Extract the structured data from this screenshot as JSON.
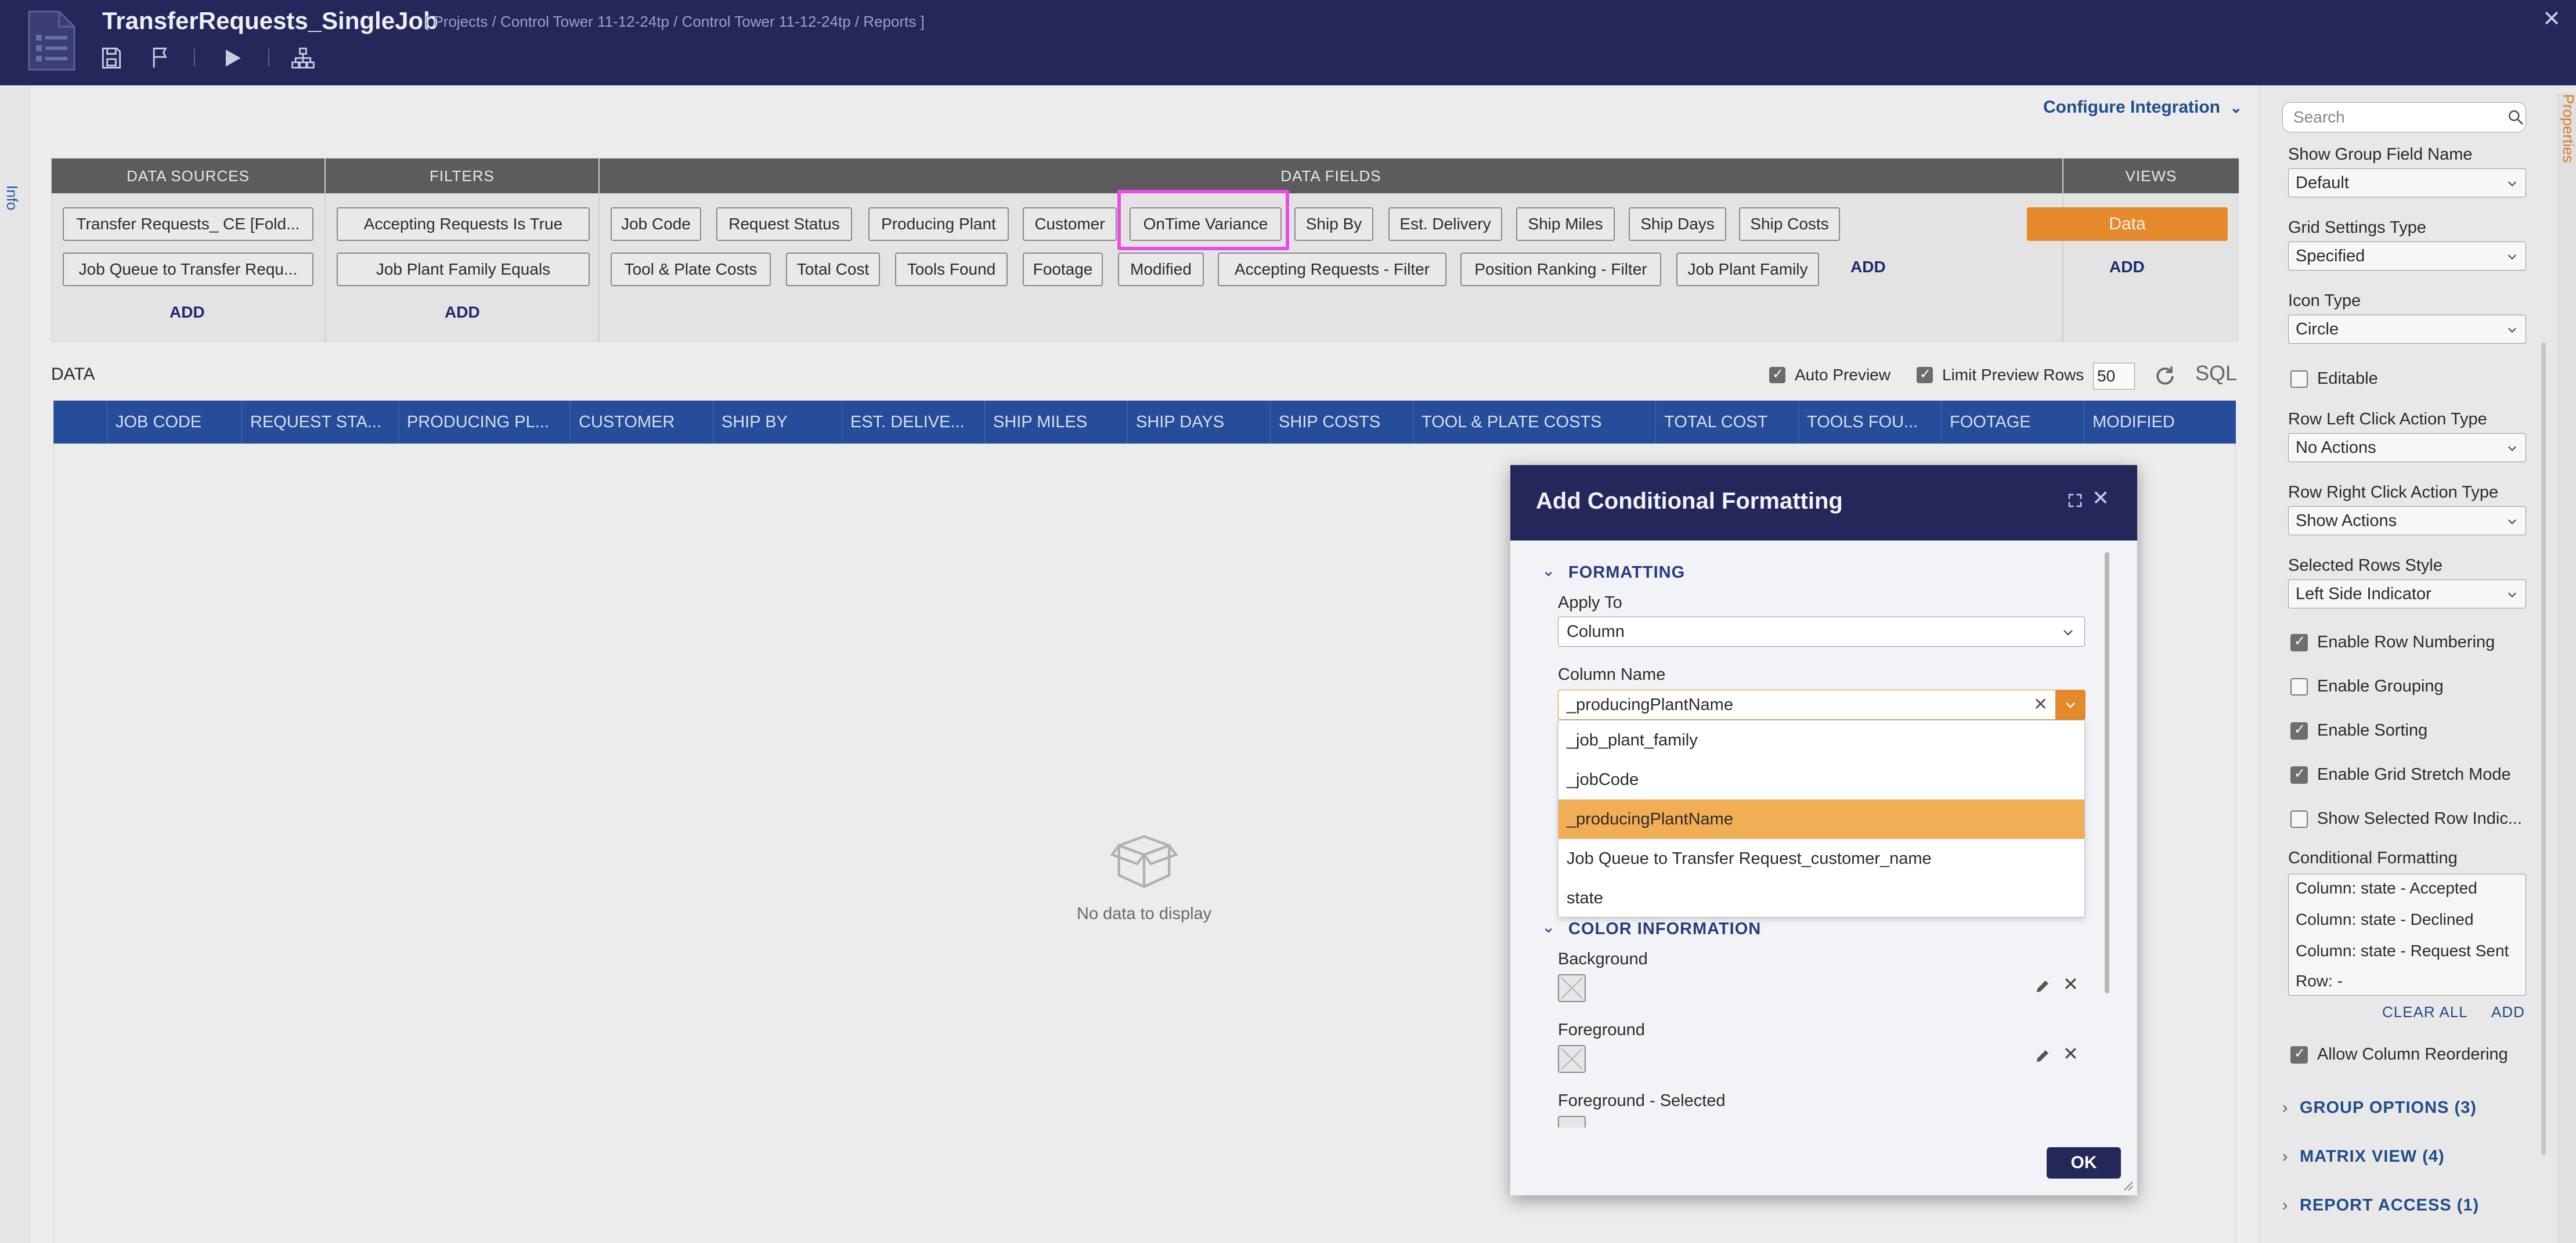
{
  "header": {
    "title": "TransferRequests_SingleJob",
    "breadcrumb": "[ Projects / Control Tower 11-12-24tp / Control Tower 11-12-24tp / Reports ]"
  },
  "sidebar": {
    "info_label": "Info"
  },
  "canvas": {
    "configure_integration": "Configure Integration"
  },
  "designer": {
    "headers": {
      "data_sources": "DATA SOURCES",
      "filters": "FILTERS",
      "data_fields": "DATA FIELDS",
      "views": "VIEWS"
    },
    "data_sources": [
      "Transfer Requests_ CE [Fold...",
      "Job Queue to Transfer Requ..."
    ],
    "filters": [
      "Accepting Requests Is True",
      "Job Plant Family Equals"
    ],
    "data_fields_row1": [
      "Job Code",
      "Request Status",
      "Producing Plant",
      "Customer",
      "OnTime Variance",
      "Ship By",
      "Est. Delivery",
      "Ship Miles",
      "Ship Days",
      "Ship Costs"
    ],
    "data_fields_row2": [
      "Tool & Plate Costs",
      "Total Cost",
      "Tools Found",
      "Footage",
      "Modified",
      "Accepting Requests - Filter",
      "Position Ranking - Filter",
      "Job Plant Family"
    ],
    "views": [
      "Data"
    ],
    "add_label": "ADD"
  },
  "data_section": {
    "title": "DATA",
    "auto_preview": "Auto Preview",
    "limit_preview_rows": "Limit Preview Rows",
    "preview_rows_value": "50",
    "sql_label": "SQL",
    "columns": [
      "JOB CODE",
      "REQUEST STA...",
      "PRODUCING PL...",
      "CUSTOMER",
      "SHIP BY",
      "EST. DELIVE...",
      "SHIP MILES",
      "SHIP DAYS",
      "SHIP COSTS",
      "TOOL & PLATE COSTS",
      "TOTAL COST",
      "TOOLS FOU...",
      "FOOTAGE",
      "MODIFIED"
    ],
    "empty_text": "No data to display"
  },
  "modal": {
    "title": "Add Conditional Formatting",
    "formatting_section": "FORMATTING",
    "apply_to_label": "Apply To",
    "apply_to_value": "Column",
    "column_name_label": "Column Name",
    "column_name_value": "_producingPlantName",
    "options": [
      "_job_plant_family",
      "_jobCode",
      "_producingPlantName",
      "Job Queue to Transfer Request_customer_name",
      "state"
    ],
    "selected_option": "_producingPlantName",
    "color_section": "COLOR INFORMATION",
    "background_label": "Background",
    "foreground_label": "Foreground",
    "foreground_selected_label": "Foreground - Selected",
    "ok_label": "OK"
  },
  "properties": {
    "tab_label": "Properties",
    "search_placeholder": "Search",
    "show_group_field_name_label": "Show Group Field Name",
    "show_group_field_name_value": "Default",
    "grid_settings_type_label": "Grid Settings Type",
    "grid_settings_type_value": "Specified",
    "icon_type_label": "Icon Type",
    "icon_type_value": "Circle",
    "editable_label": "Editable",
    "row_left_label": "Row Left Click Action Type",
    "row_left_value": "No Actions",
    "row_right_label": "Row Right Click Action Type",
    "row_right_value": "Show Actions",
    "selected_rows_label": "Selected Rows Style",
    "selected_rows_value": "Left Side Indicator",
    "enable_row_numbering": "Enable Row Numbering",
    "enable_grouping": "Enable Grouping",
    "enable_sorting": "Enable Sorting",
    "enable_grid_stretch": "Enable Grid Stretch Mode",
    "show_selected_row": "Show Selected Row Indic...",
    "conditional_formatting_label": "Conditional Formatting",
    "conditional_formatting_items": [
      "Column: state - Accepted",
      "Column: state - Declined",
      "Column: state - Request Sent",
      "Row: -"
    ],
    "clear_all": "CLEAR ALL",
    "add": "ADD",
    "allow_column_reordering": "Allow Column Reordering",
    "group_options": "GROUP OPTIONS (3)",
    "matrix_view": "MATRIX VIEW (4)",
    "report_access": "REPORT ACCESS (1)"
  },
  "colors": {
    "header_bg": "#24275a",
    "grid_header_bg": "#264d9a",
    "accent_orange": "#e58a2c",
    "selected_option": "#f2ae55",
    "highlight": "#e94ce6"
  }
}
